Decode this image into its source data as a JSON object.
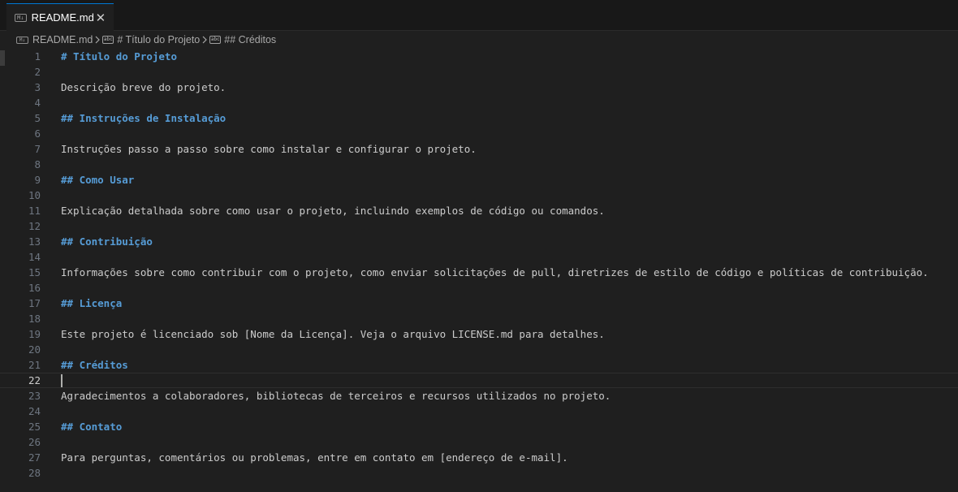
{
  "tab": {
    "file_icon": "M↓",
    "label": "README.md",
    "close_glyph": "✕"
  },
  "breadcrumb": {
    "file_icon": "M↓",
    "file": "README.md",
    "symbol_icon": "abc",
    "section1": "# Título do Projeto",
    "section2": "## Créditos"
  },
  "editor": {
    "current_line": 22,
    "lines": [
      {
        "n": "1",
        "text": "# Título do Projeto",
        "heading": true
      },
      {
        "n": "2",
        "text": "",
        "heading": false
      },
      {
        "n": "3",
        "text": "Descrição breve do projeto.",
        "heading": false
      },
      {
        "n": "4",
        "text": "",
        "heading": false
      },
      {
        "n": "5",
        "text": "## Instruções de Instalação",
        "heading": true
      },
      {
        "n": "6",
        "text": "",
        "heading": false
      },
      {
        "n": "7",
        "text": "Instruções passo a passo sobre como instalar e configurar o projeto.",
        "heading": false
      },
      {
        "n": "8",
        "text": "",
        "heading": false
      },
      {
        "n": "9",
        "text": "## Como Usar",
        "heading": true
      },
      {
        "n": "10",
        "text": "",
        "heading": false
      },
      {
        "n": "11",
        "text": "Explicação detalhada sobre como usar o projeto, incluindo exemplos de código ou comandos.",
        "heading": false
      },
      {
        "n": "12",
        "text": "",
        "heading": false
      },
      {
        "n": "13",
        "text": "## Contribuição",
        "heading": true
      },
      {
        "n": "14",
        "text": "",
        "heading": false
      },
      {
        "n": "15",
        "text": "Informações sobre como contribuir com o projeto, como enviar solicitações de pull, diretrizes de estilo de código e políticas de contribuição.",
        "heading": false
      },
      {
        "n": "16",
        "text": "",
        "heading": false
      },
      {
        "n": "17",
        "text": "## Licença",
        "heading": true
      },
      {
        "n": "18",
        "text": "",
        "heading": false
      },
      {
        "n": "19",
        "text": "Este projeto é licenciado sob [Nome da Licença]. Veja o arquivo LICENSE.md para detalhes.",
        "heading": false
      },
      {
        "n": "20",
        "text": "",
        "heading": false
      },
      {
        "n": "21",
        "text": "## Créditos",
        "heading": true
      },
      {
        "n": "22",
        "text": "",
        "heading": false
      },
      {
        "n": "23",
        "text": "Agradecimentos a colaboradores, bibliotecas de terceiros e recursos utilizados no projeto.",
        "heading": false
      },
      {
        "n": "24",
        "text": "",
        "heading": false
      },
      {
        "n": "25",
        "text": "## Contato",
        "heading": true
      },
      {
        "n": "26",
        "text": "",
        "heading": false
      },
      {
        "n": "27",
        "text": "Para perguntas, comentários ou problemas, entre em contato em [endereço de e-mail].",
        "heading": false
      },
      {
        "n": "28",
        "text": "",
        "heading": false
      }
    ]
  },
  "colors": {
    "background": "#1f1f1f",
    "heading": "#569cd6",
    "text": "#cccccc",
    "line_number": "#6e7681",
    "tab_accent": "#0078d4"
  }
}
